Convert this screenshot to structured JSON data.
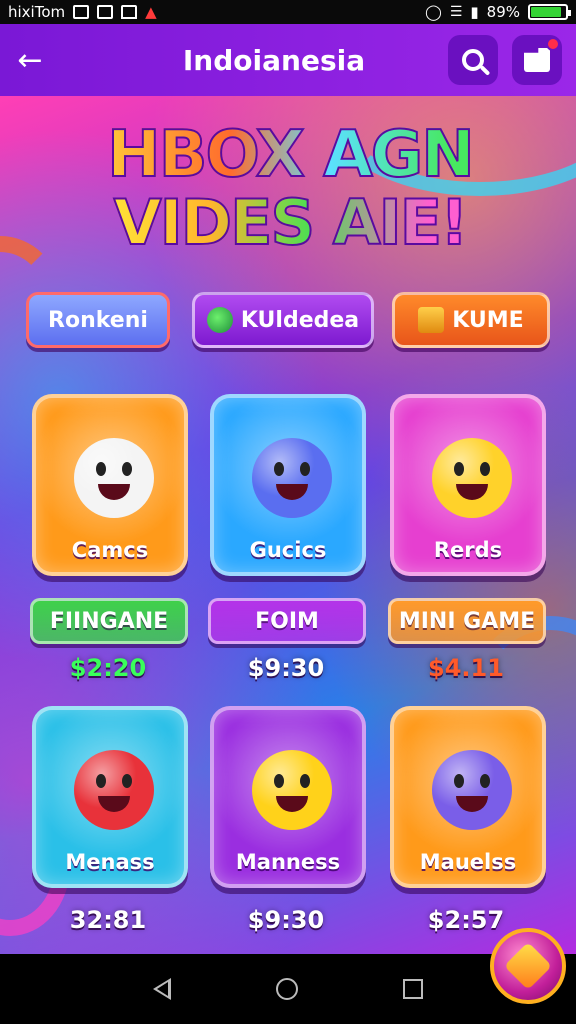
{
  "status_bar": {
    "left_text": "hixiTom",
    "battery_text": "89%",
    "battery_level": 0.89,
    "icons": [
      "photo-icon",
      "image-icon",
      "home-status-icon",
      "signal-alert-icon",
      "alarm-icon",
      "wifi-icon",
      "cell-signal-icon",
      "battery-icon"
    ]
  },
  "app_bar": {
    "title": "Indoianesia",
    "back_icon": "arrow-left-icon",
    "search_icon": "search-icon",
    "store_icon": "store-icon"
  },
  "hero": {
    "line1": "HBOX AGN",
    "line2": "VIDES AIE!"
  },
  "tabs": [
    {
      "label": "Ronkeni"
    },
    {
      "label": "KUldedea",
      "icon": "game-orb-icon"
    },
    {
      "label": "KUME",
      "icon": "gift-box-icon"
    }
  ],
  "games_row1": [
    {
      "label": "Camcs",
      "color": "#ff9a1a",
      "char_color": "#f4f4f4"
    },
    {
      "label": "Gucics",
      "color": "#2aa8ff",
      "char_color": "#5a6ef0"
    },
    {
      "label": "Rerds",
      "color": "#e63fd0",
      "char_color": "#ffd22a"
    }
  ],
  "tags_row": [
    {
      "label": "FIINGANE",
      "color": "#3fd14a",
      "price": "$2:20",
      "price_color": "#3aff5a"
    },
    {
      "label": "FOIM",
      "color": "#b433e8",
      "price": "$9:30",
      "price_color": "#ffffff"
    },
    {
      "label": "MINI GAME",
      "color": "#ff9a2a",
      "price": "$4.11",
      "price_color": "#ff5a2a"
    }
  ],
  "games_row2": [
    {
      "label": "Menass",
      "color": "#2ac0e8",
      "char_color": "#e8323a",
      "price": "32:81"
    },
    {
      "label": "Manness",
      "color": "#9a2ee0",
      "char_color": "#ffd21a",
      "price": "$9:30"
    },
    {
      "label": "Mauelss",
      "color": "#ff9a1a",
      "char_color": "#7a5ee8",
      "price": "$2:57"
    }
  ],
  "fab_icon": "magic-wand-icon",
  "nav": {
    "back_icon": "nav-back-icon",
    "home_icon": "nav-home-icon",
    "recent_icon": "nav-recent-icon"
  }
}
